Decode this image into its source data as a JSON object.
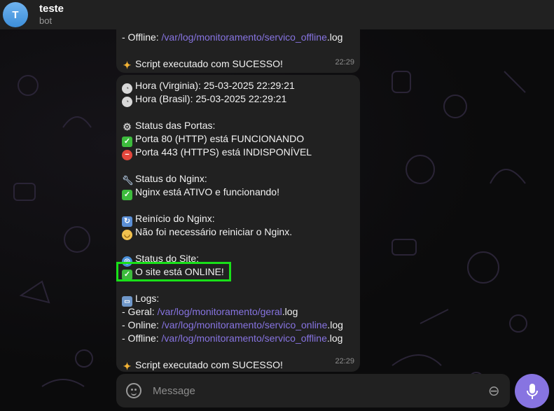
{
  "header": {
    "avatar_letter": "T",
    "title": "teste",
    "status": "bot"
  },
  "message1": {
    "line1_prefix": "- Offline: ",
    "line1_link": "/var/log/monitoramento/servico_offline",
    "line1_suffix": ".log",
    "line2": "Script executado com SUCESSO!",
    "time": "22:29"
  },
  "message2": {
    "hora_virginia": "Hora (Virginia): 25-03-2025 22:29:21",
    "hora_brasil": "Hora (Brasil): 25-03-2025 22:29:21",
    "status_portas": "Status das Portas:",
    "porta80": "Porta 80 (HTTP) está FUNCIONANDO",
    "porta443": "Porta 443 (HTTPS) está INDISPONÍVEL",
    "status_nginx": "Status do Nginx:",
    "nginx_ativo": "Nginx está ATIVO e funcionando!",
    "reinicio": "Reinício do Nginx:",
    "reinicio_msg": "Não foi necessário reiniciar o Nginx.",
    "status_site": "Status do Site:",
    "site_online": "O site está ONLINE!",
    "logs": "Logs:",
    "log_geral_prefix": "- Geral: ",
    "log_geral_link": "/var/log/monitoramento/geral",
    "log_online_prefix": "- Online: ",
    "log_online_link": "/var/log/monitoramento/servico_online",
    "log_offline_prefix": "- Offline: ",
    "log_offline_link": "/var/log/monitoramento/servico_offline",
    "log_suffix": ".log",
    "final": "Script executado com SUCESSO!",
    "time": "22:29"
  },
  "composer": {
    "placeholder": "Message"
  },
  "colors": {
    "accent": "#8774e1",
    "bubble": "#212121",
    "highlight": "#19e019"
  }
}
